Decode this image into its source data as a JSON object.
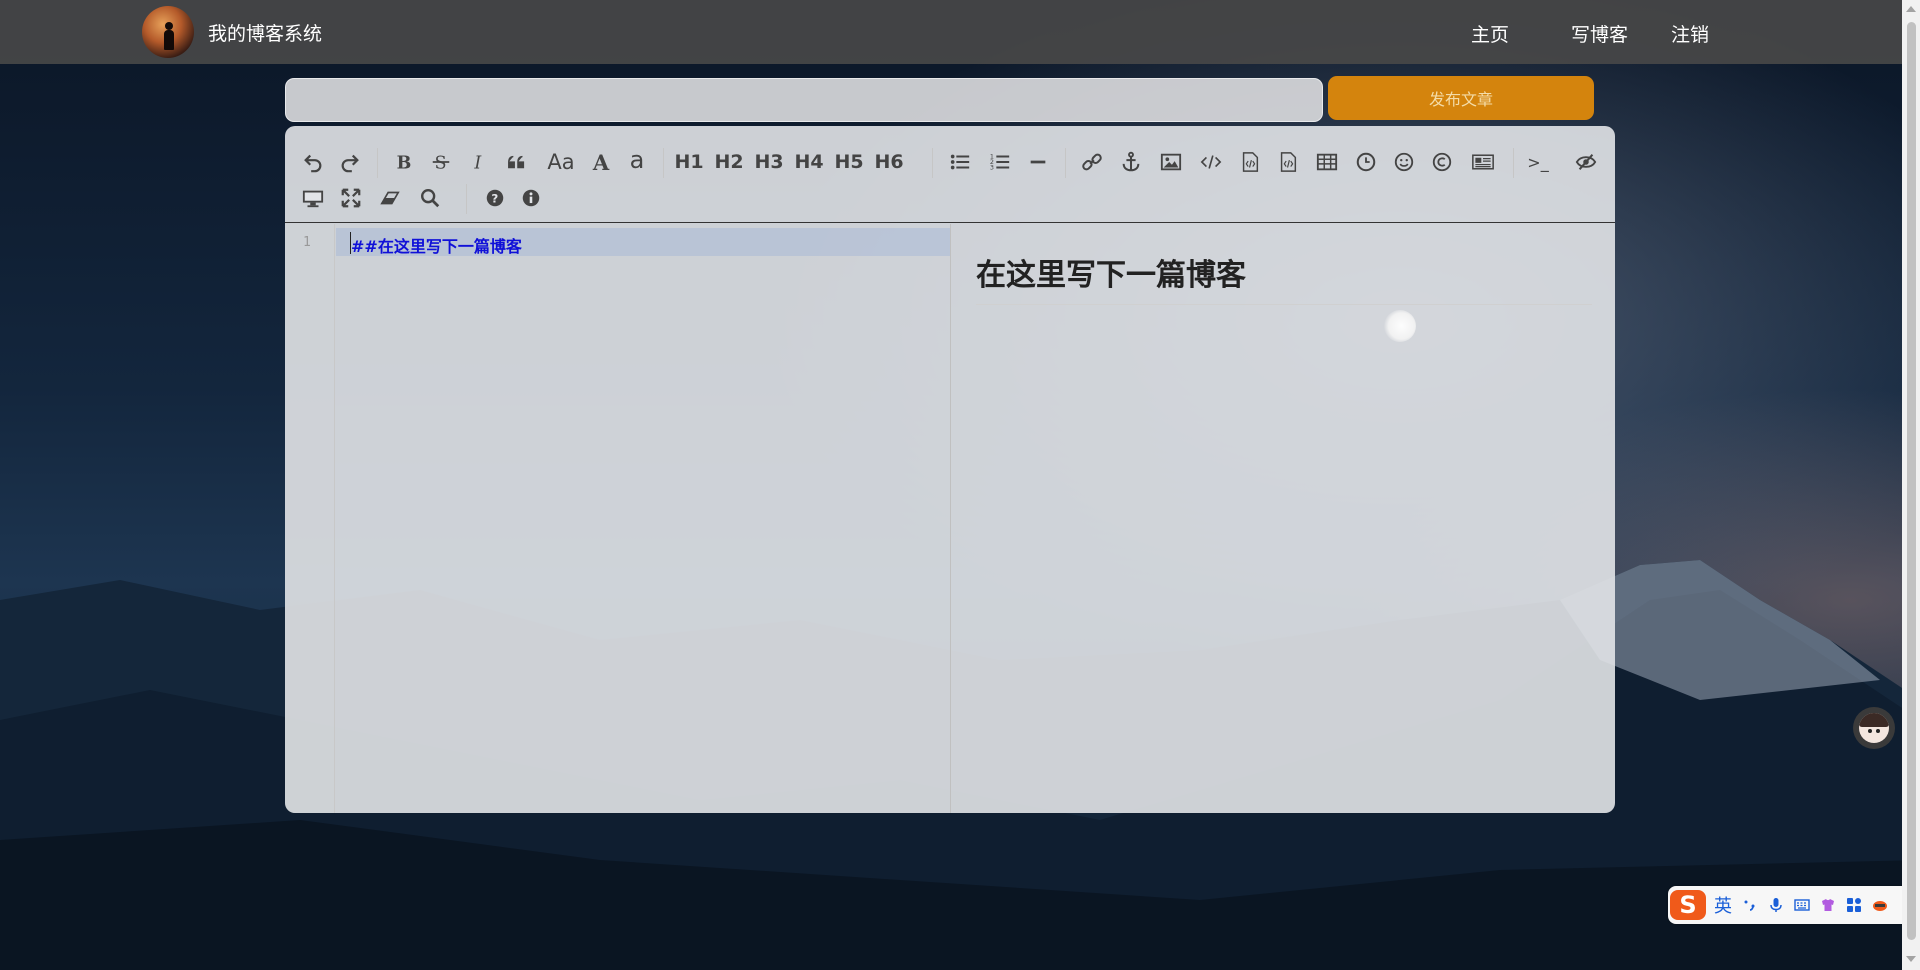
{
  "brand": {
    "title": "我的博客系统"
  },
  "nav": {
    "home": "主页",
    "write": "写博客",
    "logout": "注销"
  },
  "article": {
    "title_value": "",
    "publish_label": "发布文章"
  },
  "editor": {
    "line_number": "1",
    "markdown_text": "##在这里写下一篇博客",
    "preview_heading": "在这里写下一篇博客",
    "toolbar": {
      "font_size_label": "Aa",
      "uppercase_label": "A",
      "lowercase_label": "a",
      "h1": "H1",
      "h2": "H2",
      "h3": "H3",
      "h4": "H4",
      "h5": "H5",
      "h6": "H6",
      "terminal_label": ">_"
    }
  },
  "ime": {
    "logo": "S",
    "mode": "英"
  },
  "colors": {
    "navbar": "#484848",
    "publish": "#d4840d",
    "code_text": "#1010d8",
    "accent_ime": "#f05a1a"
  }
}
